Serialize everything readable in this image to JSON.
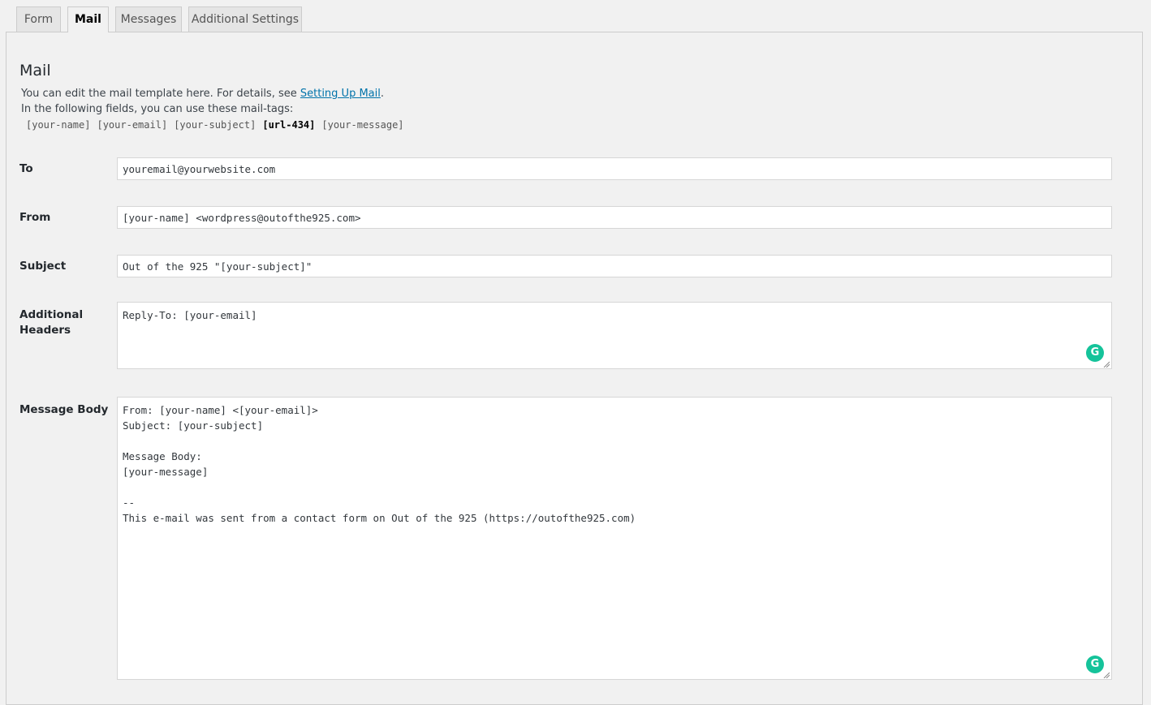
{
  "tabs": [
    {
      "label": "Form"
    },
    {
      "label": "Mail"
    },
    {
      "label": "Messages"
    },
    {
      "label": "Additional Settings"
    }
  ],
  "mail": {
    "title": "Mail",
    "desc_prefix": "You can edit the mail template here. For details, see ",
    "desc_link": "Setting Up Mail",
    "desc_suffix": ".",
    "desc_line2": "In the following fields, you can use these mail-tags:",
    "tags": [
      "[your-name]",
      "[your-email]",
      "[your-subject]",
      "[url-434]",
      "[your-message]"
    ]
  },
  "fields": {
    "to": {
      "label": "To",
      "value": "youremail@yourwebsite.com"
    },
    "from": {
      "label": "From",
      "value": "[your-name] <wordpress@outofthe925.com>"
    },
    "subject": {
      "label": "Subject",
      "value": "Out of the 925 \"[your-subject]\""
    },
    "headers": {
      "label": "Additional Headers",
      "value": "Reply-To: [your-email]"
    },
    "body": {
      "label": "Message Body",
      "value": "From: [your-name] <[your-email]>\nSubject: [your-subject]\n\nMessage Body:\n[your-message]\n\n--\nThis e-mail was sent from a contact form on Out of the 925 (https://outofthe925.com)"
    }
  },
  "icons": {
    "grammarly": "grammarly-icon",
    "grammarly_glyph": "G"
  },
  "colors": {
    "link": "#0073aa",
    "grammarly": "#15c39a"
  }
}
